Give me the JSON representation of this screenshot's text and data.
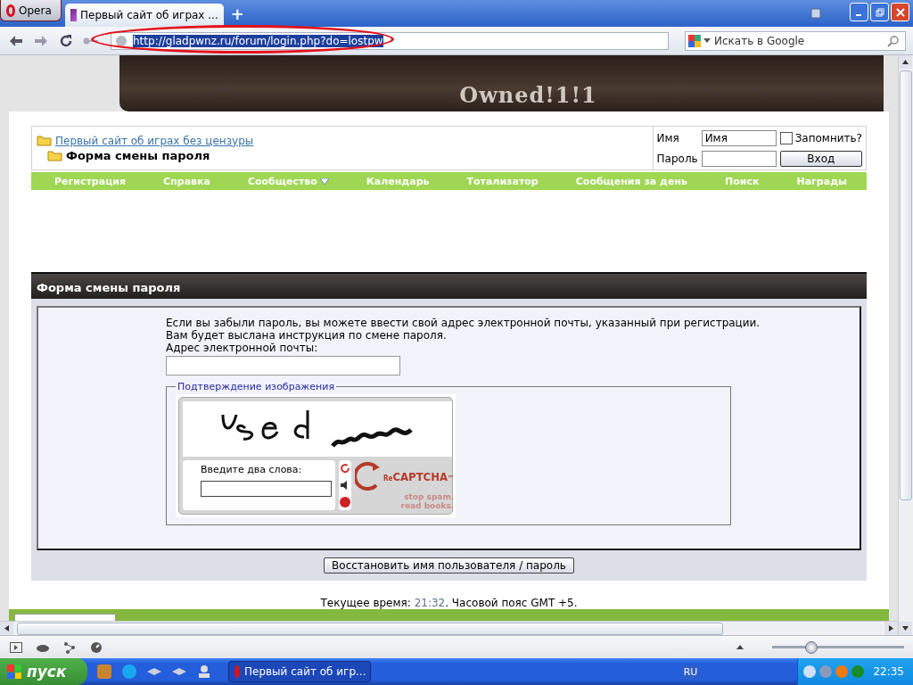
{
  "browser": {
    "menu_button": "Opera",
    "tabs": [
      {
        "title": "Первый сайт об играх ...",
        "selected": true
      }
    ],
    "new_tab": "+",
    "url": "http://gladpwnz.ru/forum/login.php?do=lostpw",
    "search": {
      "placeholder": "Искать в Google"
    }
  },
  "banner": {
    "logo": "Owned!1!1"
  },
  "breadcrumb": {
    "parent": "Первый сайт об играх без цензуры",
    "current": "Форма смены пароля"
  },
  "login": {
    "name_label": "Имя",
    "name_value": "Имя",
    "password_label": "Пароль",
    "remember": {
      "label": "Запомнить?",
      "checked": false
    },
    "button": "Вход"
  },
  "nav": [
    {
      "label": "Регистрация",
      "has_menu": false
    },
    {
      "label": "Справка",
      "has_menu": false
    },
    {
      "label": "Сообщество",
      "has_menu": true
    },
    {
      "label": "Календарь",
      "has_menu": false
    },
    {
      "label": "Тотализатор",
      "has_menu": false
    },
    {
      "label": "Сообщения за день",
      "has_menu": false
    },
    {
      "label": "Поиск",
      "has_menu": false
    },
    {
      "label": "Награды",
      "has_menu": false
    }
  ],
  "panel": {
    "title": "Форма смены пароля",
    "intro_lines": [
      "Если вы забыли пароль, вы можете ввести свой адрес электронной почты, указанный при регистрации.",
      "Вам будет выслана инструкция по смене пароля."
    ],
    "email_label": "Адрес электронной почты:",
    "captcha": {
      "legend": "Подтверждение изображения",
      "prompt": "Введите два слова:",
      "logo_prefix": "Re",
      "logo": "CAPTCHA",
      "logo_mark": "™",
      "tagline": [
        "stop spam.",
        "read books."
      ]
    },
    "submit": "Восстановить имя пользователя / пароль"
  },
  "time_line": {
    "label": "Текущее время:",
    "time": "21:32",
    "rest": ". Часовой пояс GMT +5."
  },
  "status_bar": {
    "zoom": {
      "level": 0.3
    }
  },
  "taskbar": {
    "start": "пуск",
    "tasks": [
      {
        "title": "Первый сайт об игр...",
        "selected": true
      }
    ],
    "language": "RU",
    "clock": "22:35"
  }
}
